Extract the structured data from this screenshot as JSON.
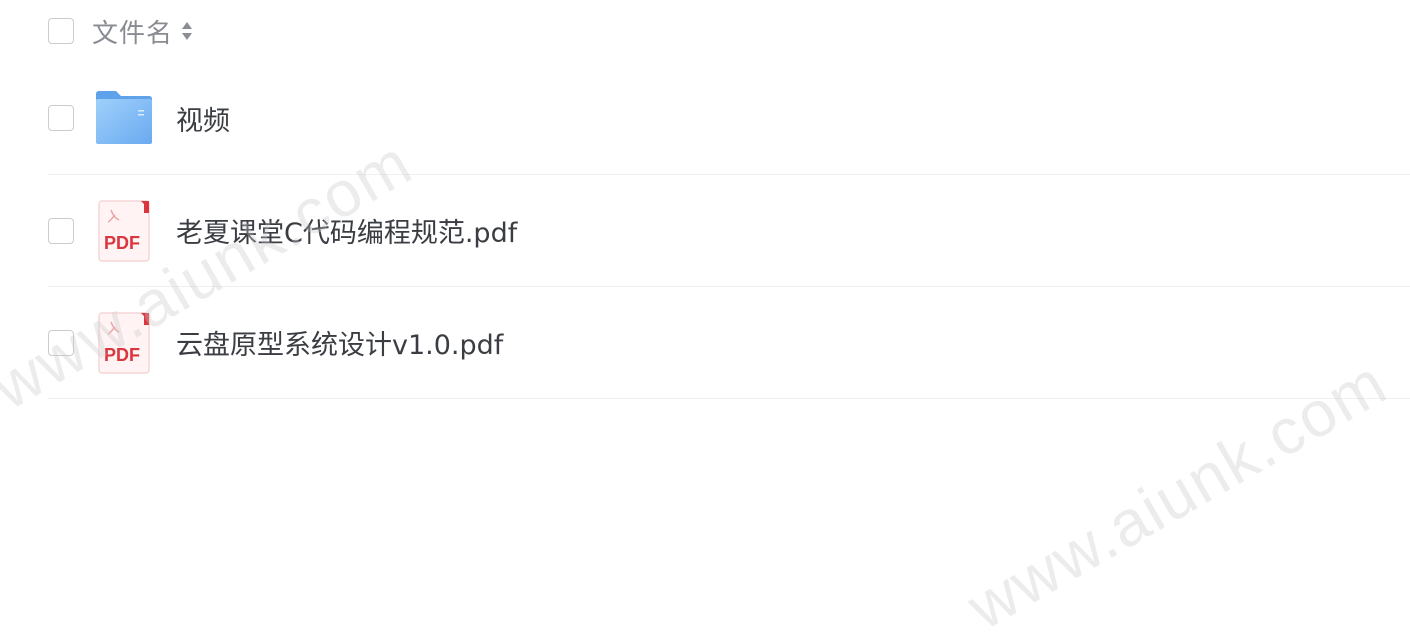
{
  "list": {
    "header": {
      "column_label": "文件名",
      "sort_icon": "sort-updown-icon"
    },
    "files": [
      {
        "name": "视频",
        "type": "folder",
        "icon": "folder-icon"
      },
      {
        "name": "老夏课堂C代码编程规范.pdf",
        "type": "pdf",
        "icon": "pdf-icon",
        "icon_label": "PDF"
      },
      {
        "name": "云盘原型系统设计v1.0.pdf",
        "type": "pdf",
        "icon": "pdf-icon",
        "icon_label": "PDF"
      }
    ]
  },
  "watermark": {
    "text": "www.aiunk.com"
  },
  "colors": {
    "folder": "#7ab8f5",
    "pdf_red": "#d9363e",
    "border": "#eef0f3"
  }
}
